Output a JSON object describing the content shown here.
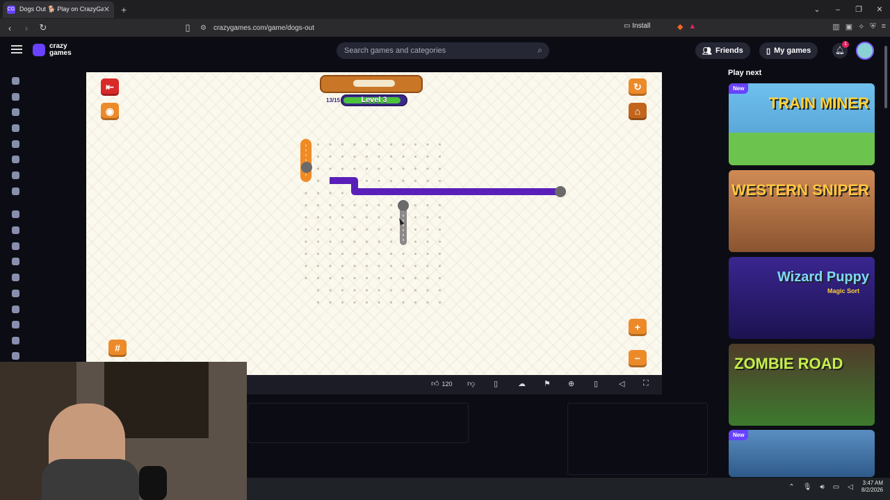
{
  "browser": {
    "tab_title": "Dogs Out 🐕 Play on CrazyGam",
    "tab_favicon": "CG",
    "url": "crazygames.com/game/dogs-out",
    "install_label": "Install"
  },
  "site": {
    "logo_line1": "crazy",
    "logo_line2": "games",
    "search_placeholder": "Search games and categories",
    "friends_label": "Friends",
    "mygames_label": "My games",
    "notification_count": "1"
  },
  "game": {
    "moves": "13/15",
    "level_label": "Level 3",
    "colors": {
      "purple_dog": "#5a1fb8",
      "orange_dog": "#f08a24",
      "gray_dog": "#8a8a8a",
      "board_bg": "#fbf8ee"
    }
  },
  "game_toolbar": {
    "like_count": "120"
  },
  "play_next": {
    "title": "Play next",
    "cards": [
      {
        "title": "TRAIN MINER",
        "badge": "New",
        "bg": "#64b4e8"
      },
      {
        "title": "WESTERN SNIPER",
        "badge": "",
        "bg": "#a86a3c"
      },
      {
        "title": "Wizard Puppy",
        "subtitle": "Magic Sort",
        "badge": "",
        "bg": "#2a1a6e"
      },
      {
        "title": "ZOMBIE ROAD",
        "badge": "",
        "bg": "#3d7a2e"
      },
      {
        "title": "",
        "badge": "New",
        "bg": "#3a6aa0"
      }
    ]
  },
  "system": {
    "time": "3:47 AM",
    "date": "8/2/2026"
  }
}
